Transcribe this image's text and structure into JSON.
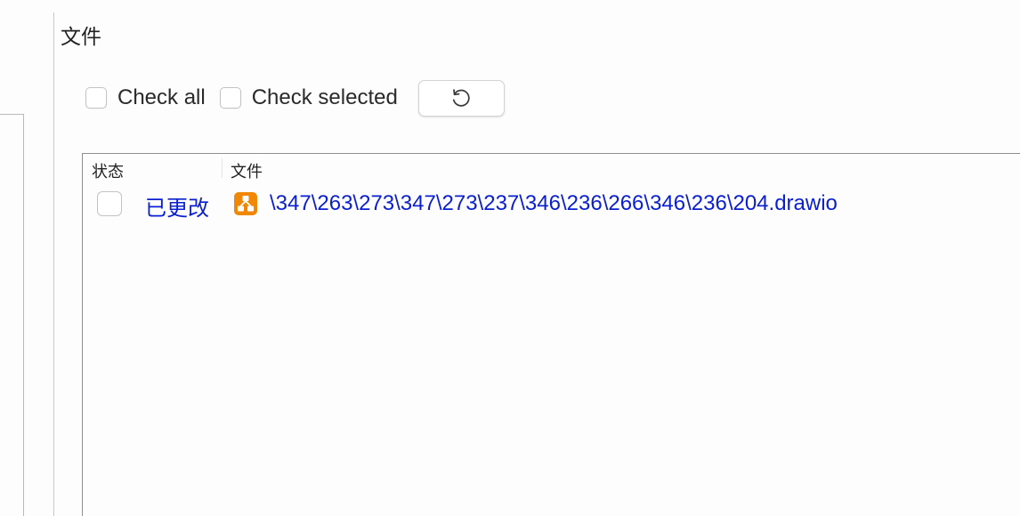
{
  "panel": {
    "title": "文件"
  },
  "toolbar": {
    "check_all_label": "Check all",
    "check_selected_label": "Check selected",
    "refresh_icon": "refresh-icon"
  },
  "table": {
    "columns": [
      "状态",
      "文件"
    ],
    "rows": [
      {
        "checked": false,
        "status": "已更改",
        "file_icon": "drawio-file-icon",
        "file_name": "\\347\\263\\273\\347\\273\\237\\346\\236\\266\\346\\236\\204.drawio"
      }
    ]
  },
  "colors": {
    "link_blue": "#0a1ed2",
    "drawio_orange": "#f08705"
  }
}
